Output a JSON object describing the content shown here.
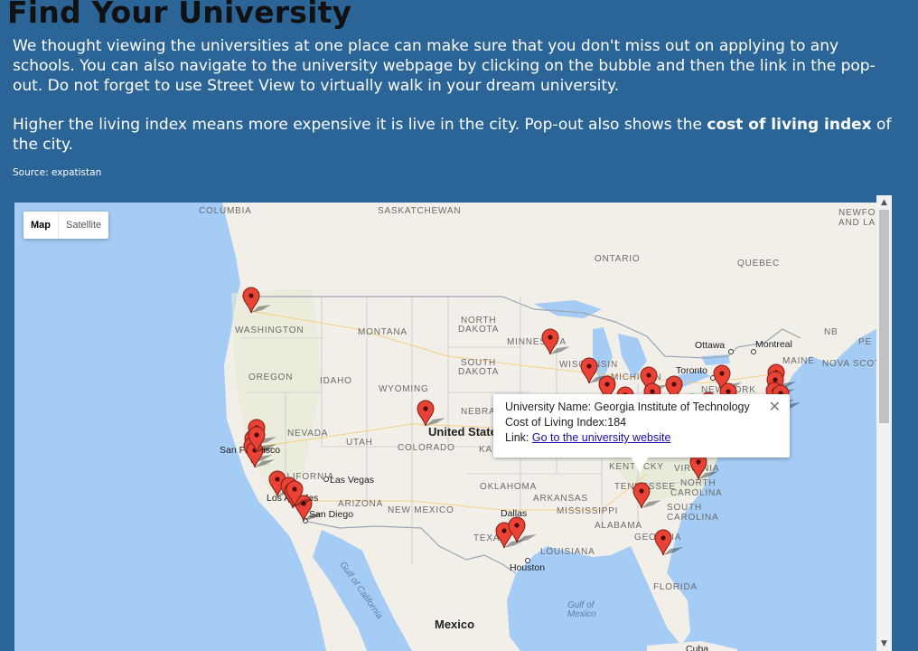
{
  "page": {
    "title": "Find Your University",
    "intro_1": "We thought viewing the universities at one place can make sure that you don't miss out on applying to any schools. You can also navigate to the university webpage by clicking on the bubble and then the link in the pop-out. Do not forget to use Street View to virtually walk in your dream university.",
    "intro_2_pre": "Higher the living index means more expensive it is live in the city. Pop-out also shows the ",
    "intro_2_bold": "cost of living index",
    "intro_2_post": " of the city.",
    "source": "Source: expatistan"
  },
  "map": {
    "map_type_buttons": [
      "Map",
      "Satellite"
    ],
    "selected_map_type": "Map",
    "region_labels": {
      "british_columbia": "COLUMBIA",
      "saskatchewan": "SASKATCHEWAN",
      "newfoundland": "NEWFOU",
      "newfoundland2": "AND LA",
      "ontario": "ONTARIO",
      "quebec": "QUEBEC",
      "washington": "WASHINGTON",
      "montana": "MONTANA",
      "north_dakota_1": "NORTH",
      "north_dakota_2": "DAKOTA",
      "minnesota": "MINNESOTA",
      "nb": "NB",
      "pe": "PE",
      "oregon": "OREGON",
      "idaho": "IDAHO",
      "south_dakota_1": "SOUTH",
      "south_dakota_2": "DAKOTA",
      "wisconsin": "WISCONSIN",
      "michigan": "MICHIGAN",
      "wyoming": "WYOMING",
      "maine": "MAINE",
      "nova_scotia": "NOVA SCOT",
      "new_york": "NEW YORK",
      "nevada": "NEVADA",
      "utah": "UTAH",
      "colorado": "COLORADO",
      "nebraska": "NEBRA",
      "kansas": "KA",
      "california": "CALIFORNIA",
      "arizona": "ARIZONA",
      "new_mexico": "NEW MEXICO",
      "oklahoma": "OKLAHOMA",
      "arkansas": "ARKANSAS",
      "tennessee": "TENNESSEE",
      "kentucky": "KENTUCKY",
      "virginia": "VIRGINIA",
      "north_carolina_1": "NORTH",
      "north_carolina_2": "CAROLINA",
      "south_carolina_1": "SOUTH",
      "south_carolina_2": "CAROLINA",
      "mississippi": "MISSISSIPPI",
      "alabama": "ALABAMA",
      "georgia": "GEORGIA",
      "texas": "TEXAS",
      "louisiana": "LOUISIANA",
      "florida": "FLORIDA"
    },
    "city_labels": {
      "ottawa": "Ottawa",
      "montreal": "Montreal",
      "toronto": "Toronto",
      "united_states": "United States",
      "san_francisco": "San Francisco",
      "las_vegas": "Las Vegas",
      "los_angeles": "Los Angeles",
      "san_diego": "San Diego",
      "dallas": "Dallas",
      "houston": "Houston",
      "mexico": "Mexico",
      "cuba": "Cuba"
    },
    "water_labels": {
      "gulf_of_california": "Gulf of California",
      "gulf_of_mexico_1": "Gulf of",
      "gulf_of_mexico_2": "Mexico"
    },
    "marker_count": 31,
    "colors": {
      "water": "#a5ccf4",
      "land": "#f2efe9",
      "marker": "#ea4335",
      "page_background": "#2b6496"
    }
  },
  "popup": {
    "university_label": "University Name:",
    "university_value": "Georgia Institute of Technology",
    "col_label": "Cost of Living Index:",
    "col_value": "184",
    "link_label": "Link:",
    "link_text": "Go to the university website",
    "close_icon": "close-icon"
  }
}
